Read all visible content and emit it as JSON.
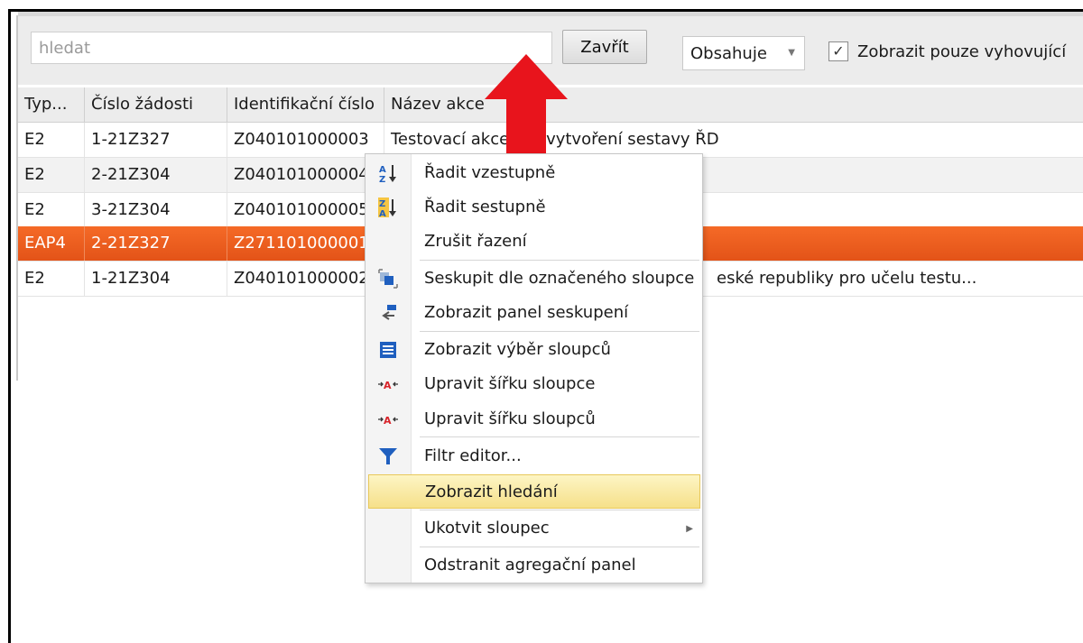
{
  "search": {
    "placeholder": "hledat",
    "close_label": "Zavřít",
    "mode": "Obsahuje",
    "filter_checked": true,
    "filter_label": "Zobrazit pouze vyhovující"
  },
  "columns": [
    "Typ...",
    "Číslo žádosti",
    "Identifikační číslo",
    "Název akce"
  ],
  "rows": [
    {
      "type": "E2",
      "num": "1-21Z327",
      "ident": "Z040101000003",
      "name": "Testovací akce pro vytvoření sestavy ŘD"
    },
    {
      "type": "E2",
      "num": "2-21Z304",
      "ident": "Z040101000004",
      "name": ""
    },
    {
      "type": "E2",
      "num": "3-21Z304",
      "ident": "Z040101000005",
      "name": ""
    },
    {
      "type": "EAP4",
      "num": "2-21Z327",
      "ident": "Z271101000001",
      "name": ""
    },
    {
      "type": "E2",
      "num": "1-21Z304",
      "ident": "Z040101000002",
      "name": "eské republiky pro učelu testu..."
    }
  ],
  "selected_row": 3,
  "context_menu": {
    "items": [
      {
        "label": "Řadit vzestupně",
        "icon": "sort-ascending-icon"
      },
      {
        "label": "Řadit sestupně",
        "icon": "sort-descending-icon"
      },
      {
        "label": "Zrušit řazení",
        "icon": ""
      },
      {
        "label": "Seskupit dle označeného sloupce",
        "icon": "group-by-column-icon"
      },
      {
        "label": "Zobrazit panel seskupení",
        "icon": "group-panel-icon"
      },
      {
        "label": "Zobrazit výběr sloupců",
        "icon": "column-chooser-icon"
      },
      {
        "label": "Upravit šířku sloupce",
        "icon": "best-fit-column-icon"
      },
      {
        "label": "Upravit šířku sloupců",
        "icon": "best-fit-columns-icon"
      },
      {
        "label": "Filtr editor...",
        "icon": "filter-icon"
      },
      {
        "label": "Zobrazit hledání",
        "icon": ""
      },
      {
        "label": "Ukotvit sloupec",
        "icon": ""
      },
      {
        "label": "Odstranit agregační panel",
        "icon": ""
      }
    ],
    "highlighted_item": 9
  },
  "colors": {
    "selected_row": "#f05e1f",
    "arrow": "#e8141c",
    "menu_highlight": "#f8e89a"
  }
}
